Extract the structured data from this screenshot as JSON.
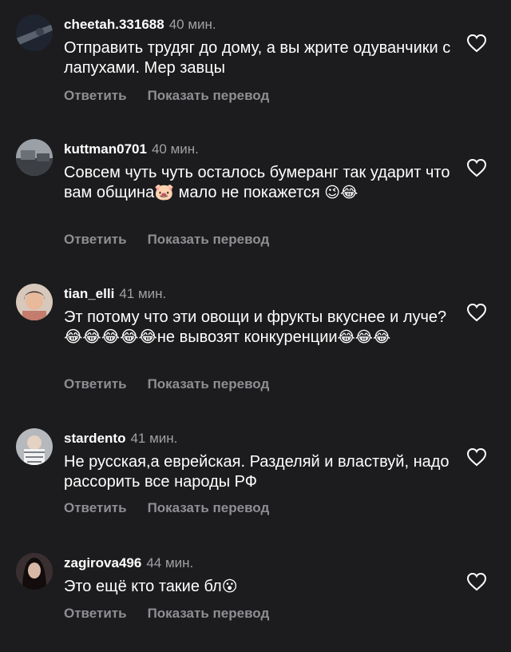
{
  "comments": [
    {
      "username": "cheetah.331688",
      "time": "40 мин.",
      "text": "Отправить трудяг до дому, а вы жрите одуванчики с лапухами. Мер завцы",
      "emoji": "",
      "reply_label": "Ответить",
      "translate_label": "Показать перевод",
      "avatar_color": "#2e3540"
    },
    {
      "username": "kuttman0701",
      "time": "40 мин.",
      "text": "Совсем чуть чуть осталось бумеранг так ударит что вам община🐷 мало не покажется ",
      "emoji": "😉😂",
      "reply_label": "Ответить",
      "translate_label": "Показать перевод",
      "avatar_color": "#5a5f66"
    },
    {
      "username": "tian_elli",
      "time": "41 мин.",
      "text": "Эт потому что эти овощи и фрукты вкуснее и луче?😂😂😂😂😂не вывозят конкуренции",
      "emoji": "😂😂😂",
      "reply_label": "Ответить",
      "translate_label": "Показать перевод",
      "avatar_color": "#c9a38a"
    },
    {
      "username": "stardento",
      "time": "41 мин.",
      "text": "Не русская,а еврейская. Разделяй и властвуй, надо рассорить все народы РФ",
      "emoji": "",
      "reply_label": "Ответить",
      "translate_label": "Показать перевод",
      "avatar_color": "#8a8f96"
    },
    {
      "username": "zagirova496",
      "time": "44 мин.",
      "text": "Это ещё кто такие бл",
      "emoji": "😮",
      "reply_label": "Ответить",
      "translate_label": "Показать перевод",
      "avatar_color": "#2a2020"
    }
  ],
  "colors": {
    "background": "#1c1c1e",
    "text": "#ffffff",
    "secondary": "#a0a0a5",
    "action": "#8e8e93"
  },
  "icons": {
    "like": "heart-icon"
  }
}
